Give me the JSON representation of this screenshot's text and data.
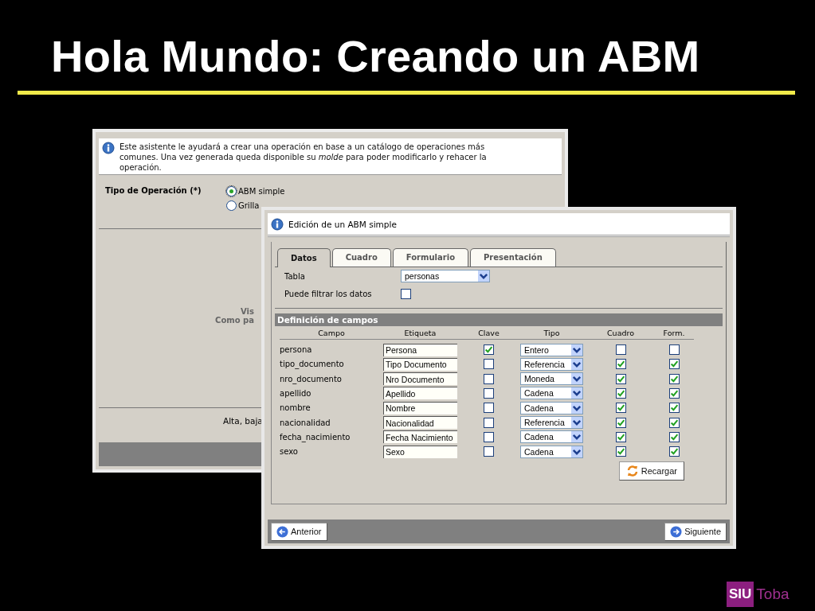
{
  "slide_title": "Hola Mundo: Creando un ABM",
  "back_window": {
    "info": "Este asistente le ayudará a crear una operación en base a un catálogo de operaciones más comunes. Una vez generada queda disponible su *molde* para poder modificarlo y rehacer la operación.",
    "field_label": "Tipo de Operación (*)",
    "options": [
      {
        "label": "ABM simple",
        "selected": true
      },
      {
        "label": "Grilla",
        "selected": false
      }
    ],
    "preview_lines": [
      "Vis",
      "Como pa"
    ],
    "footer_text": "Alta, baja"
  },
  "front_window": {
    "title": "Edición de un ABM simple",
    "tabs": [
      {
        "label": "Datos",
        "selected": true
      },
      {
        "label": "Cuadro",
        "selected": false
      },
      {
        "label": "Formulario",
        "selected": false
      },
      {
        "label": "Presentación",
        "selected": false
      }
    ],
    "tabla": {
      "label": "Tabla",
      "value": "personas"
    },
    "filtrar": {
      "label": "Puede filtrar los datos",
      "checked": false
    },
    "section_title": "Definición de campos",
    "columns": [
      "Campo",
      "Etiqueta",
      "Clave",
      "Tipo",
      "Cuadro",
      "Form."
    ],
    "rows": [
      {
        "campo": "persona",
        "etiqueta": "Persona",
        "clave": true,
        "tipo": "Entero",
        "cuadro": false,
        "form": false
      },
      {
        "campo": "tipo_documento",
        "etiqueta": "Tipo Documento",
        "clave": false,
        "tipo": "Referencia",
        "cuadro": true,
        "form": true
      },
      {
        "campo": "nro_documento",
        "etiqueta": "Nro Documento",
        "clave": false,
        "tipo": "Moneda",
        "cuadro": true,
        "form": true
      },
      {
        "campo": "apellido",
        "etiqueta": "Apellido",
        "clave": false,
        "tipo": "Cadena",
        "cuadro": true,
        "form": true
      },
      {
        "campo": "nombre",
        "etiqueta": "Nombre",
        "clave": false,
        "tipo": "Cadena",
        "cuadro": true,
        "form": true
      },
      {
        "campo": "nacionalidad",
        "etiqueta": "Nacionalidad",
        "clave": false,
        "tipo": "Referencia",
        "cuadro": true,
        "form": true
      },
      {
        "campo": "fecha_nacimiento",
        "etiqueta": "Fecha Nacimiento",
        "clave": false,
        "tipo": "Cadena",
        "cuadro": true,
        "form": true
      },
      {
        "campo": "sexo",
        "etiqueta": "Sexo",
        "clave": false,
        "tipo": "Cadena",
        "cuadro": true,
        "form": true
      }
    ],
    "reload_button": "Recargar",
    "back_button": "Anterior",
    "next_button": "Siguiente"
  },
  "logo": {
    "mark": "SIU",
    "name": "Toba"
  }
}
